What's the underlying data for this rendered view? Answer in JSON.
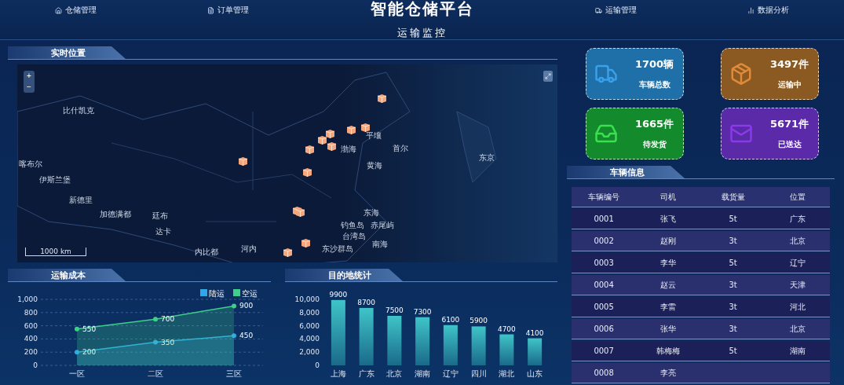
{
  "header": {
    "nav_left": [
      "仓储管理",
      "订单管理"
    ],
    "title": "智能仓储平台",
    "nav_right": [
      "运输管理",
      "数据分析"
    ],
    "subtitle": "运输监控"
  },
  "location": {
    "title": "实时位置",
    "zoom_in": "+",
    "zoom_out": "−",
    "scale": "1000 km",
    "map_labels": [
      "比什凯克",
      "喀布尔",
      "伊斯兰堡",
      "新德里",
      "加德满都",
      "廷布",
      "达卡",
      "内比都",
      "河内",
      "渤海",
      "平壤",
      "首尔",
      "黄海",
      "东京",
      "东海",
      "钓鱼岛",
      "赤尾屿",
      "台湾岛",
      "东沙群岛",
      "南海"
    ]
  },
  "stats": [
    {
      "value": "1700辆",
      "label": "车辆总数",
      "color": "#1f6fa8"
    },
    {
      "value": "3497件",
      "label": "运输中",
      "color": "#8a5a22"
    },
    {
      "value": "1665件",
      "label": "待发货",
      "color": "#138a2c"
    },
    {
      "value": "5671件",
      "label": "已送达",
      "color": "#5a2aa8"
    }
  ],
  "vehicles": {
    "title": "车辆信息",
    "columns": [
      "车辆编号",
      "司机",
      "载货量",
      "位置"
    ],
    "rows": [
      [
        "0001",
        "张飞",
        "5t",
        "广东"
      ],
      [
        "0002",
        "赵刚",
        "3t",
        "北京"
      ],
      [
        "0003",
        "李华",
        "5t",
        "辽宁"
      ],
      [
        "0004",
        "赵云",
        "3t",
        "天津"
      ],
      [
        "0005",
        "李雷",
        "3t",
        "河北"
      ],
      [
        "0006",
        "张华",
        "3t",
        "北京"
      ],
      [
        "0007",
        "韩梅梅",
        "5t",
        "湖南"
      ],
      [
        "0008",
        "李亮"
      ]
    ]
  },
  "cost": {
    "title": "运输成本",
    "chart_data": {
      "type": "line",
      "categories": [
        "一区",
        "二区",
        "三区"
      ],
      "series": [
        {
          "name": "陆运",
          "color": "#2fa8e8",
          "marker": "circle",
          "values": [
            200,
            350,
            450
          ]
        },
        {
          "name": "空运",
          "color": "#3fcf8a",
          "marker": "circle",
          "values": [
            550,
            700,
            900
          ]
        }
      ],
      "grid": true,
      "legend": true,
      "ylim": [
        0,
        1000
      ],
      "yticks": [
        0,
        200,
        400,
        600,
        800,
        {
          "value": 1000,
          "label": "1,000"
        }
      ],
      "data_labels": true
    }
  },
  "destinations": {
    "title": "目的地统计",
    "chart_data": {
      "type": "bar",
      "categories": [
        "上海",
        "广东",
        "北京",
        "湖南",
        "辽宁",
        "四川",
        "湖北",
        "山东"
      ],
      "values": [
        9900,
        8700,
        7500,
        7300,
        6100,
        5900,
        4700,
        4100
      ],
      "ylim": [
        0,
        10000
      ],
      "yticks": [
        0,
        {
          "value": 2000,
          "label": "2,000"
        },
        {
          "value": 4000,
          "label": "4,000"
        },
        {
          "value": 6000,
          "label": "6,000"
        },
        {
          "value": 8000,
          "label": "8,000"
        },
        {
          "value": 10000,
          "label": "10,000"
        }
      ],
      "data_labels": true
    }
  }
}
